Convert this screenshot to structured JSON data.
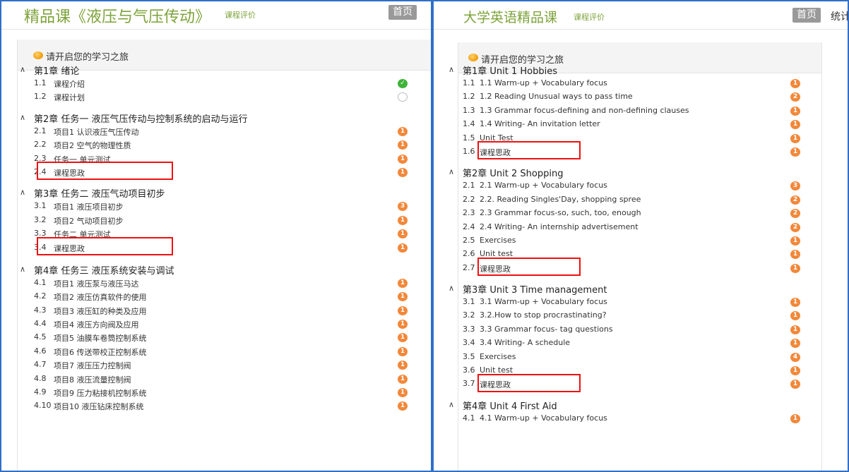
{
  "left": {
    "title": "精品课《液压与气压传动》",
    "eval_link": "课程评价",
    "home": "首页",
    "journey": "请开启您的学习之旅",
    "chapters": [
      {
        "title": "第1章 绪论",
        "lessons": [
          {
            "num": "1.1",
            "title": "课程介绍",
            "status": "done"
          },
          {
            "num": "1.2",
            "title": "课程计划",
            "status": "empty"
          }
        ]
      },
      {
        "title": "第2章 任务一 液压气压传动与控制系统的启动与运行",
        "lessons": [
          {
            "num": "2.1",
            "title": "项目1 认识液压气压传动",
            "badge": "1"
          },
          {
            "num": "2.2",
            "title": "项目2 空气的物理性质",
            "badge": "1"
          },
          {
            "num": "2.3",
            "title": "任务一 单元测试",
            "badge": "1"
          },
          {
            "num": "2.4",
            "title": "课程思政",
            "badge": "1",
            "highlight": true
          }
        ]
      },
      {
        "title": "第3章 任务二 液压气动项目初步",
        "lessons": [
          {
            "num": "3.1",
            "title": "项目1 液压项目初步",
            "badge": "3"
          },
          {
            "num": "3.2",
            "title": "项目2 气动项目初步",
            "badge": "1"
          },
          {
            "num": "3.3",
            "title": "任务二 单元测试",
            "badge": "1"
          },
          {
            "num": "3.4",
            "title": "课程思政",
            "badge": "1",
            "highlight": true
          }
        ]
      },
      {
        "title": "第4章 任务三 液压系统安装与调试",
        "lessons": [
          {
            "num": "4.1",
            "title": "项目1 液压泵与液压马达",
            "badge": "1"
          },
          {
            "num": "4.2",
            "title": "项目2 液压仿真软件的使用",
            "badge": "1"
          },
          {
            "num": "4.3",
            "title": "项目3 液压缸的种类及应用",
            "badge": "1"
          },
          {
            "num": "4.4",
            "title": "项目4 液压方向阀及应用",
            "badge": "1"
          },
          {
            "num": "4.5",
            "title": "项目5 油膜车卷筒控制系统",
            "badge": "1"
          },
          {
            "num": "4.6",
            "title": "项目6 传送带校正控制系统",
            "badge": "1"
          },
          {
            "num": "4.7",
            "title": "项目7 液压压力控制阀",
            "badge": "1"
          },
          {
            "num": "4.8",
            "title": "项目8 液压流量控制阀",
            "badge": "1"
          },
          {
            "num": "4.9",
            "title": "项目9 压力粘接机控制系统",
            "badge": "1"
          },
          {
            "num": "4.10",
            "title": "项目10 液压钻床控制系统",
            "badge": "1"
          }
        ]
      }
    ]
  },
  "right": {
    "title": "大学英语精品课",
    "eval_link": "课程评价",
    "home": "首页",
    "stats": "统计",
    "journey": "请开启您的学习之旅",
    "chapters": [
      {
        "title": "第1章 Unit 1 Hobbies",
        "lessons": [
          {
            "num": "1.1",
            "title": "1.1 Warm-up + Vocabulary focus",
            "badge": "1"
          },
          {
            "num": "1.2",
            "title": "1.2 Reading Unusual ways to pass time",
            "badge": "2"
          },
          {
            "num": "1.3",
            "title": "1.3 Grammar focus-defining and non-defining clauses",
            "badge": "1"
          },
          {
            "num": "1.4",
            "title": "1.4 Writing- An invitation letter",
            "badge": "1"
          },
          {
            "num": "1.5",
            "title": "Unit Test",
            "badge": "1"
          },
          {
            "num": "1.6",
            "title": "课程思政",
            "badge": "1",
            "highlight": true
          }
        ]
      },
      {
        "title": "第2章 Unit 2 Shopping",
        "lessons": [
          {
            "num": "2.1",
            "title": "2.1 Warm-up + Vocabulary focus",
            "badge": "3"
          },
          {
            "num": "2.2",
            "title": "2.2. Reading Singles'Day, shopping spree",
            "badge": "2"
          },
          {
            "num": "2.3",
            "title": "2.3 Grammar focus-so, such, too, enough",
            "badge": "2"
          },
          {
            "num": "2.4",
            "title": "2.4 Writing- An internship advertisement",
            "badge": "2"
          },
          {
            "num": "2.5",
            "title": "Exercises",
            "badge": "1"
          },
          {
            "num": "2.6",
            "title": "Unit test",
            "badge": "1"
          },
          {
            "num": "2.7",
            "title": "课程思政",
            "badge": "1",
            "highlight": true
          }
        ]
      },
      {
        "title": "第3章 Unit 3 Time management",
        "lessons": [
          {
            "num": "3.1",
            "title": "3.1 Warm-up + Vocabulary focus",
            "badge": "1"
          },
          {
            "num": "3.2",
            "title": "3.2.How to stop procrastinating?",
            "badge": "1"
          },
          {
            "num": "3.3",
            "title": "3.3 Grammar focus- tag questions",
            "badge": "1"
          },
          {
            "num": "3.4",
            "title": "3.4 Writing- A schedule",
            "badge": "1"
          },
          {
            "num": "3.5",
            "title": "Exercises",
            "badge": "4"
          },
          {
            "num": "3.6",
            "title": "Unit test",
            "badge": "1"
          },
          {
            "num": "3.7",
            "title": "课程思政",
            "badge": "1",
            "highlight": true
          }
        ]
      },
      {
        "title": "第4章 Unit 4 First Aid",
        "lessons": [
          {
            "num": "4.1",
            "title": "4.1 Warm-up + Vocabulary focus",
            "badge": "1"
          }
        ]
      }
    ]
  }
}
